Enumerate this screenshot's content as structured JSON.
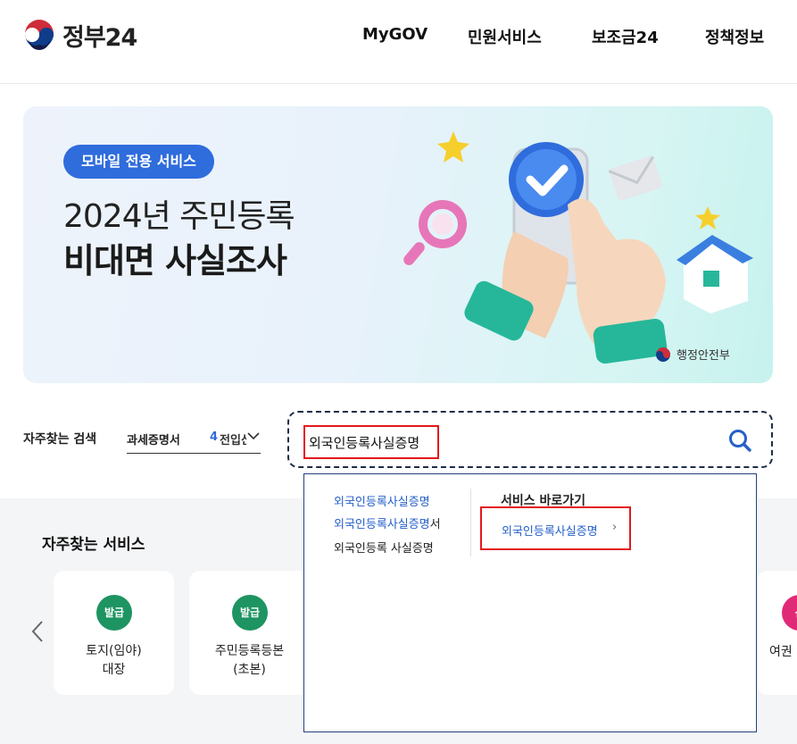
{
  "header": {
    "logo_text": "정부24",
    "nav": [
      "MyGOV",
      "민원서비스",
      "보조금24",
      "정책정보"
    ]
  },
  "banner": {
    "badge": "모바일 전용 서비스",
    "title_line1": "2024년 주민등록",
    "title_line2": "비대면 사실조사",
    "ministry": "행정안전부"
  },
  "search": {
    "fav_label": "자주찾는 검색",
    "fav_keyword": "과세증명서",
    "fav_rank": "4",
    "fav_next": "전입신고",
    "query": "외국인등록사실증명",
    "icon": "search-icon"
  },
  "dropdown": {
    "suggestions": [
      {
        "highlight": "외국인등록사실증명",
        "rest": ""
      },
      {
        "highlight": "외국인등록사실증명",
        "rest": "서"
      },
      {
        "highlight": "",
        "rest": "외국인등록 사실증명"
      }
    ],
    "shortcut_title": "서비스 바로가기",
    "shortcut_link": "외국인등록사실증명"
  },
  "frequent": {
    "title": "자주찾는 서비스",
    "cards": [
      {
        "badge": "발급",
        "line1": "토지(임야)",
        "line2": "대장"
      },
      {
        "badge": "발급",
        "line1": "주민등록등본",
        "line2": "(초본)"
      }
    ],
    "partial_card": {
      "badge": "신",
      "label": "여권 재"
    }
  },
  "colors": {
    "accent": "#2f6cdc",
    "link": "#2560c8",
    "highlight_box": "#e3191c",
    "issue_badge": "#1d9462",
    "apply_badge": "#e02a78"
  }
}
